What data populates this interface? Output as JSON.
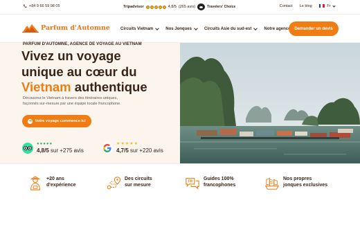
{
  "topbar": {
    "phone": "+84 9 66 59 98 05",
    "tripadvisor_label": "Tripadvisor",
    "ta_rating": "4,8/5",
    "ta_count": "(265 avis)",
    "travelers_choice": "Travelers' Choice",
    "links": [
      "Contact",
      "Le blog"
    ],
    "language": "Fr"
  },
  "logo": {
    "text": "Parfum d'Automne"
  },
  "nav": {
    "items": [
      "Circuits Vietnam",
      "Nos Jonques",
      "Circuits Asie du sud-est",
      "Notre agence"
    ],
    "cta": "Demander un devis"
  },
  "hero": {
    "eyebrow": "PARFUM D'AUTOMNE, AGENCE DE VOYAGE AU VIETNAM",
    "headline_1": "Vivez un voyage",
    "headline_2": "unique au cœur du",
    "headline_highlight": "Vietnam",
    "headline_3": " authentique",
    "lede_1": "Découvrez le Vietnam à travers des itinéraires uniques,",
    "lede_2": "façonnés sur-mesure par une équipe locale francophone.",
    "cta": "Votre voyage commence ici"
  },
  "ratings": [
    {
      "source": "tripadvisor",
      "score": "4,8/5",
      "suffix": " sur +275 avis"
    },
    {
      "source": "google",
      "score": "4,7/5",
      "suffix": " sur +220 avis"
    }
  ],
  "features": [
    {
      "line1": "+20 ans",
      "line2": "d'expérience",
      "icon": "guide-icon"
    },
    {
      "line1": "Des circuits",
      "line2": "sur mesure",
      "icon": "route-icon"
    },
    {
      "line1": "Guides 100%",
      "line2": "francophones",
      "icon": "chat-fr-icon"
    },
    {
      "line1": "Nos propres",
      "line2": "jonques exclusives",
      "icon": "junk-boat-icon"
    }
  ],
  "colors": {
    "accent": "#f07d14",
    "text": "#3a2418",
    "hero_bg": "#fbf5ee",
    "tripadvisor_green": "#34e0a1"
  }
}
